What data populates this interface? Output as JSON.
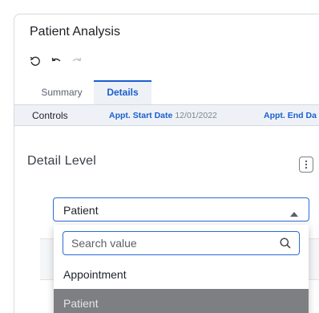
{
  "app": {
    "title": "Patient Analysis"
  },
  "toolbar": {
    "icons": [
      "reset-icon",
      "undo-icon",
      "redo-icon"
    ]
  },
  "tabs": [
    {
      "label": "Summary",
      "active": false
    },
    {
      "label": "Details",
      "active": true
    }
  ],
  "controls": {
    "label": "Controls",
    "filters": [
      {
        "name": "Appt. Start Date",
        "value": "12/01/2022"
      },
      {
        "name": "Appt. End Da",
        "value": ""
      }
    ]
  },
  "panel": {
    "title": "Detail Level",
    "select": {
      "value": "Patient",
      "expanded": true
    },
    "dropdown": {
      "search_placeholder": "Search value",
      "search_value": "",
      "options": [
        {
          "label": "Appointment",
          "selected": false
        },
        {
          "label": "Patient",
          "selected": true
        }
      ]
    }
  },
  "colors": {
    "accent": "#1a5fd0",
    "tab_bg": "#eef1f6",
    "selected_option_bg": "#7d7f82"
  }
}
